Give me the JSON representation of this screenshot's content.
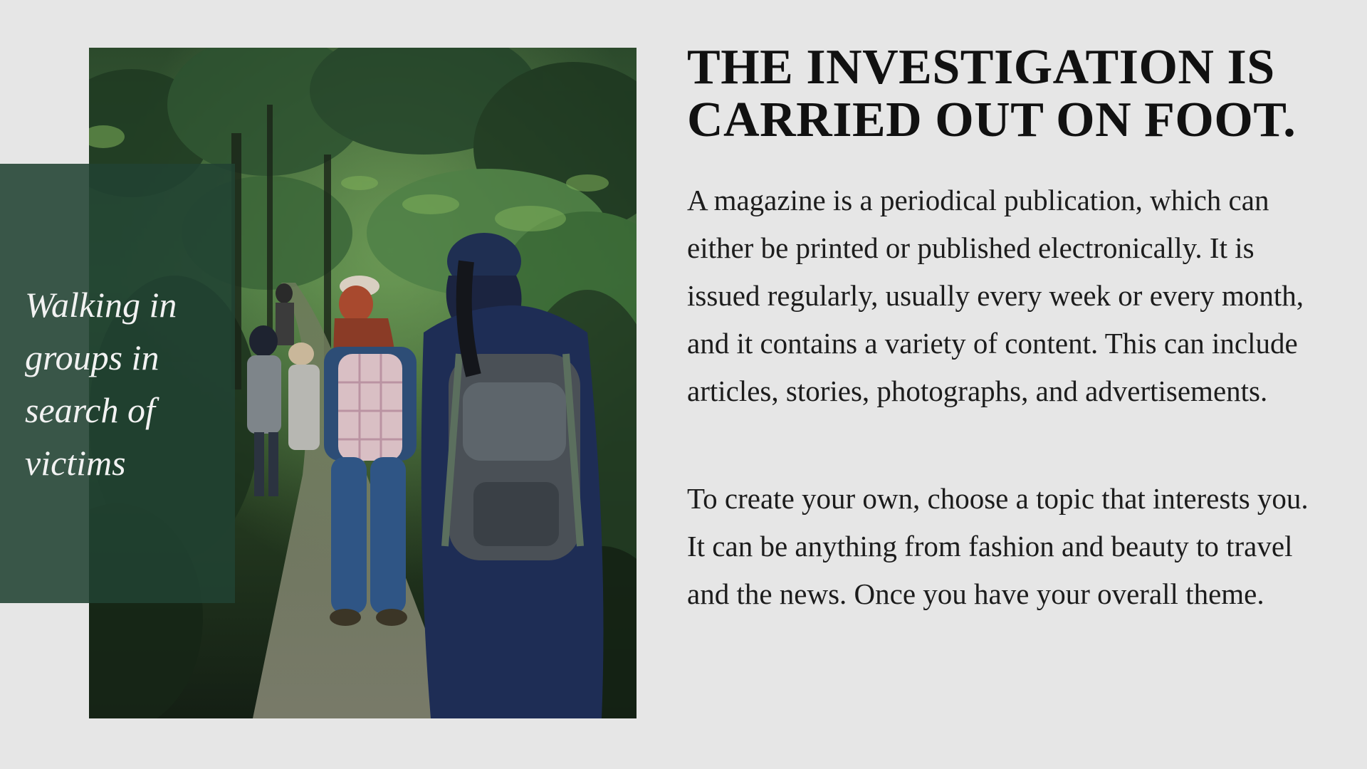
{
  "photo": {
    "subject": "hikers-on-forest-trail"
  },
  "caption": {
    "text": "Walking in groups in search of victims"
  },
  "article": {
    "headline": "THE INVESTIGATION IS CARRIED OUT ON FOOT.",
    "paragraphs": [
      "A magazine is a periodical publication, which can either be printed or published electronically. It is issued regularly, usually every week or every month, and it contains a variety of content. This can include articles, stories, photographs, and advertisements.",
      "To create your own, choose a topic that interests you. It can be anything from fashion and beauty to travel and the news. Once you have your overall theme."
    ]
  },
  "colors": {
    "background": "#e6e6e6",
    "caption_panel": "#214232",
    "caption_text": "#f2f2f2",
    "headline": "#111111",
    "body_text": "#1c1c1c"
  }
}
